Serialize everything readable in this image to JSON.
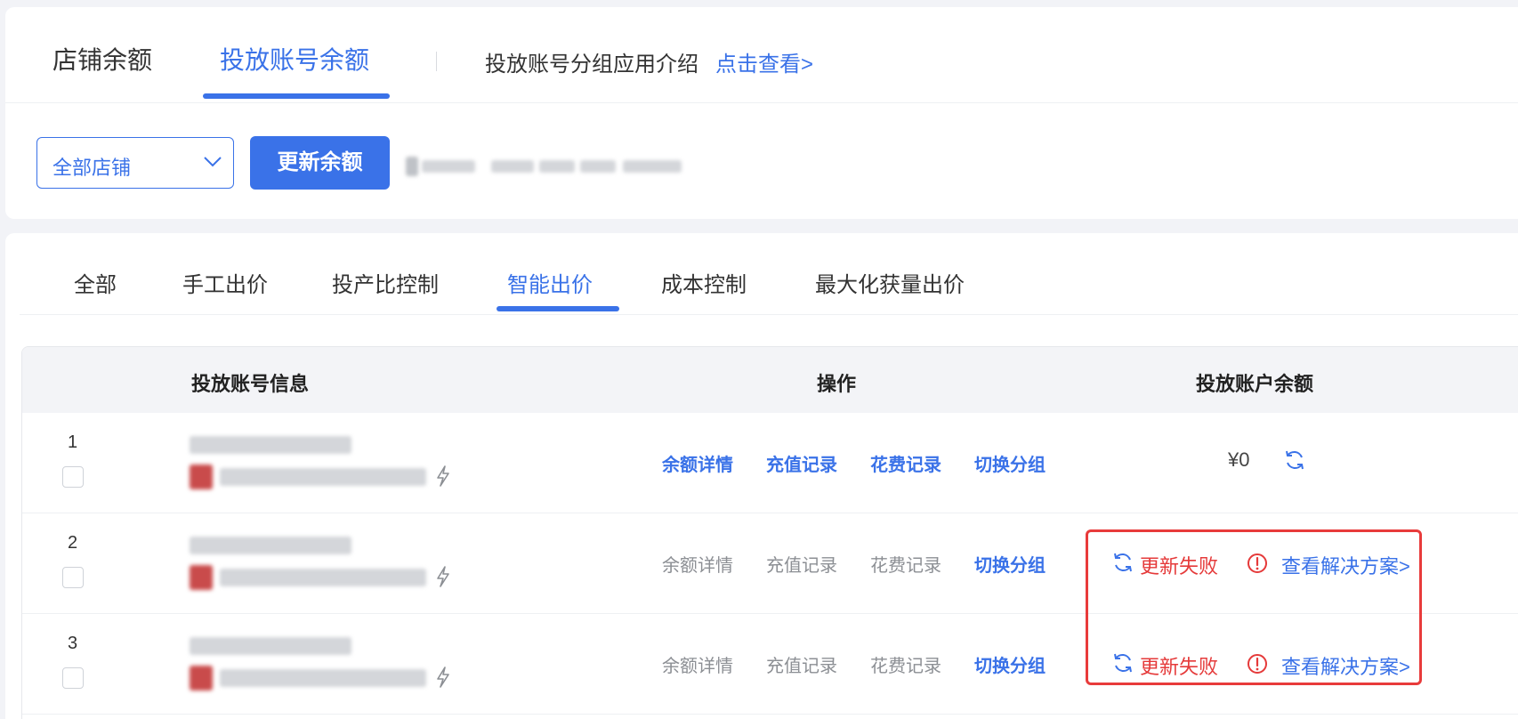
{
  "top_tabs": [
    {
      "label": "店铺余额",
      "active": false
    },
    {
      "label": "投放账号余额",
      "active": true
    }
  ],
  "intro": {
    "text": "投放账号分组应用介绍",
    "link": "点击查看>"
  },
  "store_select": {
    "value": "全部店铺"
  },
  "update_button": "更新余额",
  "sub_tabs": [
    {
      "label": "全部",
      "active": false
    },
    {
      "label": "手工出价",
      "active": false
    },
    {
      "label": "投产比控制",
      "active": false
    },
    {
      "label": "智能出价",
      "active": true
    },
    {
      "label": "成本控制",
      "active": false
    },
    {
      "label": "最大化获量出价",
      "active": false
    }
  ],
  "table": {
    "headers": {
      "account": "投放账号信息",
      "actions": "操作",
      "balance": "投放账户余额"
    },
    "rows": [
      {
        "num": "1",
        "actions": [
          "余额详情",
          "充值记录",
          "花费记录",
          "切换分组"
        ],
        "actions_enabled": true,
        "balance": "¥0",
        "status": "ok"
      },
      {
        "num": "2",
        "actions": [
          "余额详情",
          "充值记录",
          "花费记录",
          "切换分组"
        ],
        "actions_enabled": false,
        "fail_text": "更新失败",
        "solution": "查看解决方案>",
        "status": "failed"
      },
      {
        "num": "3",
        "actions": [
          "余额详情",
          "充值记录",
          "花费记录",
          "切换分组"
        ],
        "actions_enabled": false,
        "fail_text": "更新失败",
        "solution": "查看解决方案>",
        "status": "failed"
      }
    ]
  },
  "colors": {
    "accent": "#3a72e8",
    "error": "#e53a3a",
    "highlight_border": "#e83b3b",
    "disabled_text": "#8c8f94"
  },
  "icons": [
    "chevron-down-icon",
    "refresh-icon",
    "alert-circle-icon",
    "bolt-icon"
  ]
}
